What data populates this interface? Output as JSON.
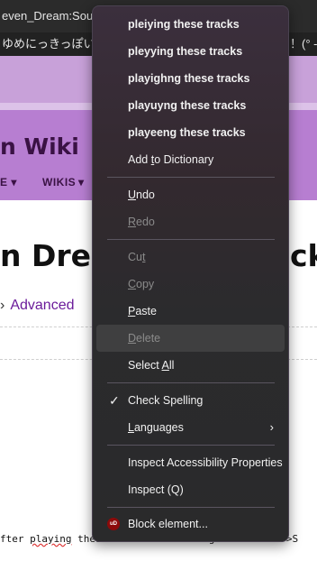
{
  "background": {
    "titlebar_text": "even_Dream:Sou",
    "tab_text": "ゆめにっきっぽいゲ",
    "tab_text_right": "！(° -°",
    "wiki_title": "n Wiki",
    "nav_left": "E ▾",
    "nav_wikis": "WIKIS",
    "nav_caret": "▾",
    "page_title": "n Dream",
    "page_title_right": "ck",
    "advanced_chevron": "›",
    "advanced_link": "Advanced",
    "code_prefix": "fter ",
    "code_squiggle": "playing",
    "code_middle": " these tracks in the right order.",
    "code_suffix": "<br>S"
  },
  "context_menu": {
    "suggestions": [
      "pleiying these tracks",
      "pleyying these tracks",
      "playighng these tracks",
      "playuyng these tracks",
      "playeeng these tracks"
    ],
    "add_to_dictionary": {
      "before": "Add ",
      "key": "t",
      "after": "o Dictionary"
    },
    "undo": {
      "key": "U",
      "rest": "ndo"
    },
    "redo": {
      "key": "R",
      "rest": "edo"
    },
    "cut": {
      "before": "Cu",
      "key": "t",
      "after": ""
    },
    "copy": {
      "key": "C",
      "rest": "opy"
    },
    "paste": {
      "key": "P",
      "rest": "aste"
    },
    "delete": {
      "key": "D",
      "rest": "elete"
    },
    "select_all": {
      "before": "Select ",
      "key": "A",
      "after": "ll"
    },
    "check_spelling": "Check Spelling",
    "check_glyph": "✓",
    "languages": {
      "key": "L",
      "rest": "anguages"
    },
    "submenu_glyph": "›",
    "inspect_accessibility": "Inspect Accessibility Properties",
    "inspect": "Inspect (Q)",
    "block_element": "Block element...",
    "block_icon_text": "uD"
  },
  "colors": {
    "menu_bg": "#2b2b2d",
    "menu_text": "#f1f1f1",
    "menu_disabled": "#8a8a8a",
    "header_purple": "#b77ed1",
    "link_purple": "#6b1b9a"
  }
}
